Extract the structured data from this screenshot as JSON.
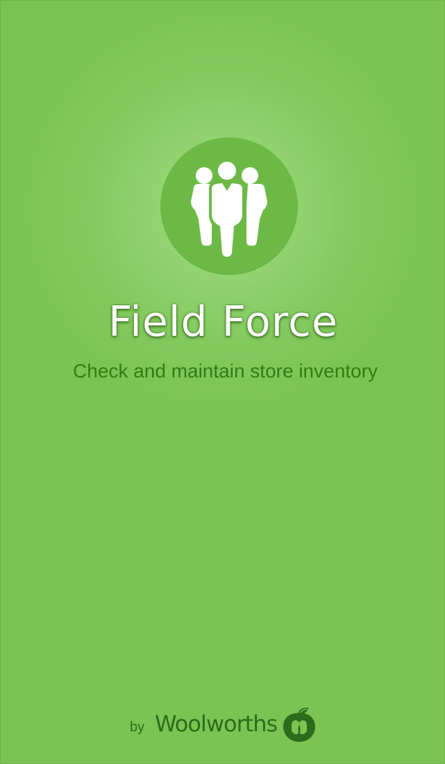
{
  "splash": {
    "title": "Field Force",
    "tagline": "Check and maintain store inventory",
    "logo_icon": "team-people-icon"
  },
  "footer": {
    "by": "by",
    "brand": "Woolworths",
    "brand_icon": "woolworths-logo-mark"
  },
  "colors": {
    "background": "#7ac453",
    "circle": "#6cba45",
    "tagline": "#2f7d12",
    "brand": "#2b6c1a"
  }
}
